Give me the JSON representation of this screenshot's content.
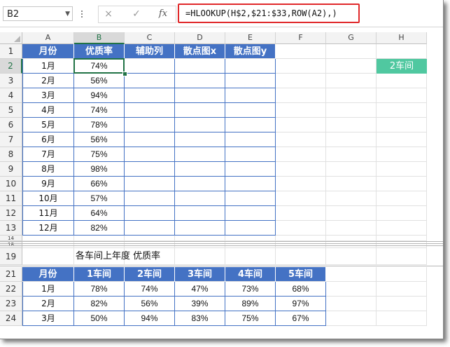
{
  "formula_bar": {
    "name_box": "B2",
    "cancel_icon": "×",
    "enter_icon": "✓",
    "fx_label": "fx",
    "formula": "=HLOOKUP(H$2,$21:$33,ROW(A2),)"
  },
  "columns": [
    "A",
    "B",
    "C",
    "D",
    "E",
    "F",
    "G",
    "H"
  ],
  "rows": [
    "1",
    "2",
    "3",
    "4",
    "5",
    "6",
    "7",
    "8",
    "9",
    "10",
    "11",
    "12",
    "13",
    "14",
    "18",
    "19",
    "21",
    "22",
    "23",
    "24"
  ],
  "table1": {
    "headers": [
      "月份",
      "优质率",
      "辅助列",
      "散点图x",
      "散点图y"
    ],
    "months": [
      "1月",
      "2月",
      "3月",
      "4月",
      "5月",
      "6月",
      "7月",
      "8月",
      "9月",
      "10月",
      "11月",
      "12月"
    ],
    "rates": [
      "74%",
      "56%",
      "94%",
      "74%",
      "78%",
      "56%",
      "75%",
      "98%",
      "66%",
      "57%",
      "64%",
      "82%"
    ]
  },
  "h2_value": "2车间",
  "section_title": "各车间上年度 优质率",
  "table2": {
    "headers": [
      "月份",
      "1车间",
      "2车间",
      "3车间",
      "4车间",
      "5车间"
    ],
    "rows": [
      [
        "1月",
        "78%",
        "74%",
        "47%",
        "73%",
        "68%"
      ],
      [
        "2月",
        "82%",
        "56%",
        "39%",
        "89%",
        "97%"
      ],
      [
        "3月",
        "50%",
        "94%",
        "83%",
        "75%",
        "67%"
      ]
    ]
  },
  "colors": {
    "header_blue": "#4472c4",
    "selection_green": "#217346",
    "teal_cell": "#50c8a0",
    "formula_highlight": "#e0282a"
  }
}
